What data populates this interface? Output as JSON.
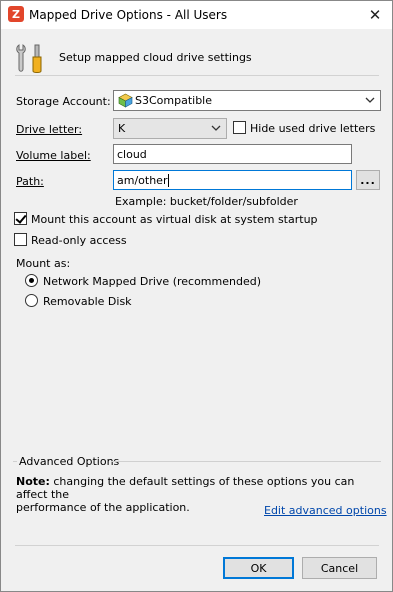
{
  "window": {
    "title": "Mapped Drive Options - All Users",
    "close_glyph": "✕",
    "app_icon_letter": "Z"
  },
  "header": {
    "text": "Setup mapped cloud drive settings",
    "icon": "tools-icon"
  },
  "form": {
    "storage_account": {
      "label": "Storage Account:",
      "value": "S3Compatible",
      "icon": "s3-cube-icon"
    },
    "drive_letter": {
      "label": "Drive letter:",
      "value": "K"
    },
    "hide_used": {
      "label": "Hide used drive letters",
      "checked": false
    },
    "volume_label": {
      "label": "Volume label:",
      "value": "cloud"
    },
    "path": {
      "label": "Path:",
      "value": "am/other",
      "browse_label": "...",
      "example": "Example: bucket/folder/subfolder"
    },
    "mount_startup": {
      "label": "Mount this account as virtual disk at system startup",
      "checked": true
    },
    "read_only": {
      "label": "Read-only access",
      "checked": false
    },
    "mount_as": {
      "label": "Mount as:",
      "options": [
        {
          "label": "Network Mapped Drive (recommended)",
          "selected": true
        },
        {
          "label": "Removable Disk",
          "selected": false
        }
      ]
    }
  },
  "advanced": {
    "title": "Advanced Options",
    "note_prefix": "Note:",
    "note_line1": " changing the default settings of these options you can affect the",
    "note_line2": "performance of the application.",
    "link": "Edit advanced options"
  },
  "buttons": {
    "ok": "OK",
    "cancel": "Cancel"
  },
  "colors": {
    "accent": "#0078d7",
    "link": "#0047ab",
    "app_icon": "#e2462b"
  }
}
